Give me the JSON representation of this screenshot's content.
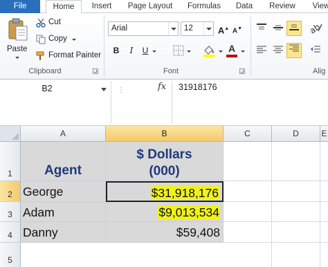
{
  "tabs": [
    "File",
    "Home",
    "Insert",
    "Page Layout",
    "Formulas",
    "Data",
    "Review",
    "View"
  ],
  "clipboard": {
    "group_label": "Clipboard",
    "paste_label": "Paste",
    "cut_label": "Cut",
    "copy_label": "Copy",
    "format_painter_label": "Format Painter"
  },
  "font": {
    "group_label": "Font",
    "font_name": "Arial",
    "font_size": "12",
    "bold": "B",
    "italic": "I",
    "underline": "U",
    "grow": "A",
    "shrink": "A",
    "font_color_letter": "A",
    "font_color": "#c00000",
    "highlight_color": "#ffff00"
  },
  "alignment": {
    "group_label": "Alig"
  },
  "formula_bar": {
    "name_box": "B2",
    "fx": "fx",
    "value": "31918176"
  },
  "grid": {
    "columns": [
      "A",
      "B",
      "C",
      "D",
      "E"
    ],
    "rows": [
      "1",
      "2",
      "3",
      "4",
      "5"
    ],
    "header": {
      "agent": "Agent",
      "dollars_line1": "$ Dollars",
      "dollars_line2": "(000)"
    },
    "data": [
      {
        "agent": "George",
        "dollars": "$31,918,176",
        "highlight": true
      },
      {
        "agent": "Adam",
        "dollars": "$9,013,534",
        "highlight": true
      },
      {
        "agent": "Danny",
        "dollars": "$59,408",
        "highlight": false
      }
    ],
    "shade_color": "#d9d9d9",
    "highlight_color": "#f0f21a",
    "header_text_color": "#1f3a7a"
  }
}
